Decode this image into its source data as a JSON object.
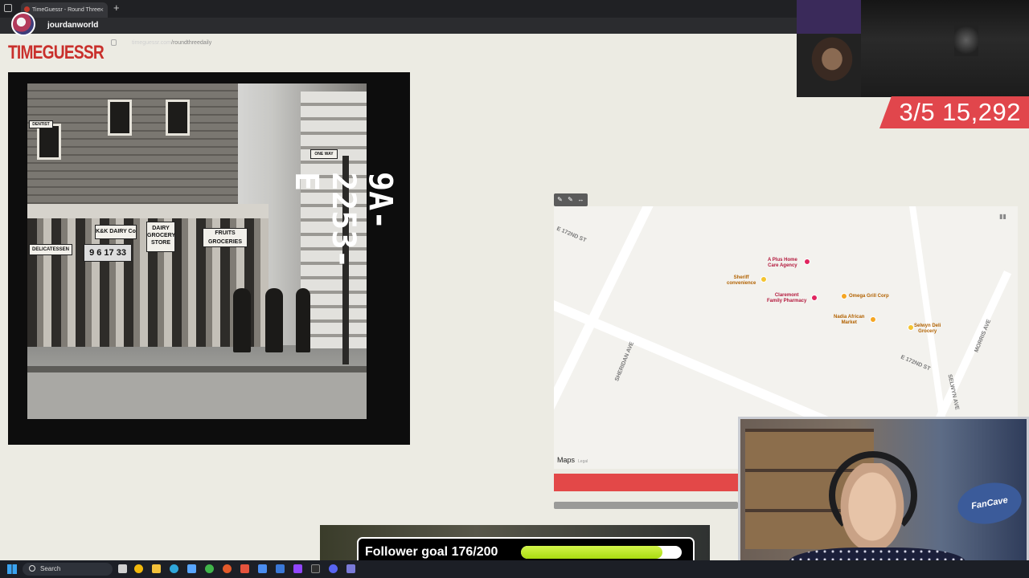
{
  "browser": {
    "tab_title": "TimeGuessr - Round Three",
    "url_host": "timeguessr.com",
    "url_path": "/roundthreedaily"
  },
  "stream": {
    "channel_name": "jourdanworld",
    "score_text": "3/5 15,292",
    "follower_goal_label": "Follower goal 176/200",
    "follower_goal_progress": 0.88,
    "cam_brand": "FanCave"
  },
  "page": {
    "logo_text": "TIMEGUESSR"
  },
  "photo": {
    "edge_marking": "9A-2253-E",
    "signs": {
      "dairy": "DAIRY and GROCERY STORE",
      "dairy_short": "DAIRY",
      "grocery": "GROCERY",
      "store": "STORE",
      "fruits": "FRUITS GROCERIES",
      "kosher": "K&K DAIRY Co",
      "price": "9 6 17 33",
      "delicatessen": "DELICATESSEN",
      "dentist": "DENTIST",
      "street": "ONE WAY"
    }
  },
  "map": {
    "streets": {
      "e172_top": "E 172ND ST",
      "e172_right": "E 172ND ST",
      "sheridan": "SHERIDAN AVE",
      "selwyn": "SELWYN AVE",
      "morris": "MORRIS AVE"
    },
    "pois": {
      "aplus_1": "A Plus Home",
      "aplus_2": "Care Agency",
      "sheriff_1": "Sheriff",
      "sheriff_2": "convenience",
      "claremont_1": "Claremont",
      "claremont_2": "Family Pharmacy",
      "omega": "Omega Grill Corp",
      "nadia_1": "Nadia African",
      "nadia_2": "Market",
      "selwyn_1": "Selwyn Deli",
      "selwyn_2": "Grocery"
    },
    "brand": "Maps",
    "legal": "Legal",
    "colors": {
      "poi_red": "#e0245e",
      "poi_orange": "#f5a623",
      "poi_yellow": "#f4c430"
    }
  },
  "taskbar": {
    "search_placeholder": "Search"
  },
  "colors": {
    "brand_red": "#c9302c",
    "score_bg": "#e1464c",
    "guess_bar": "#e34848",
    "goal_fill": "#a9dc10"
  }
}
